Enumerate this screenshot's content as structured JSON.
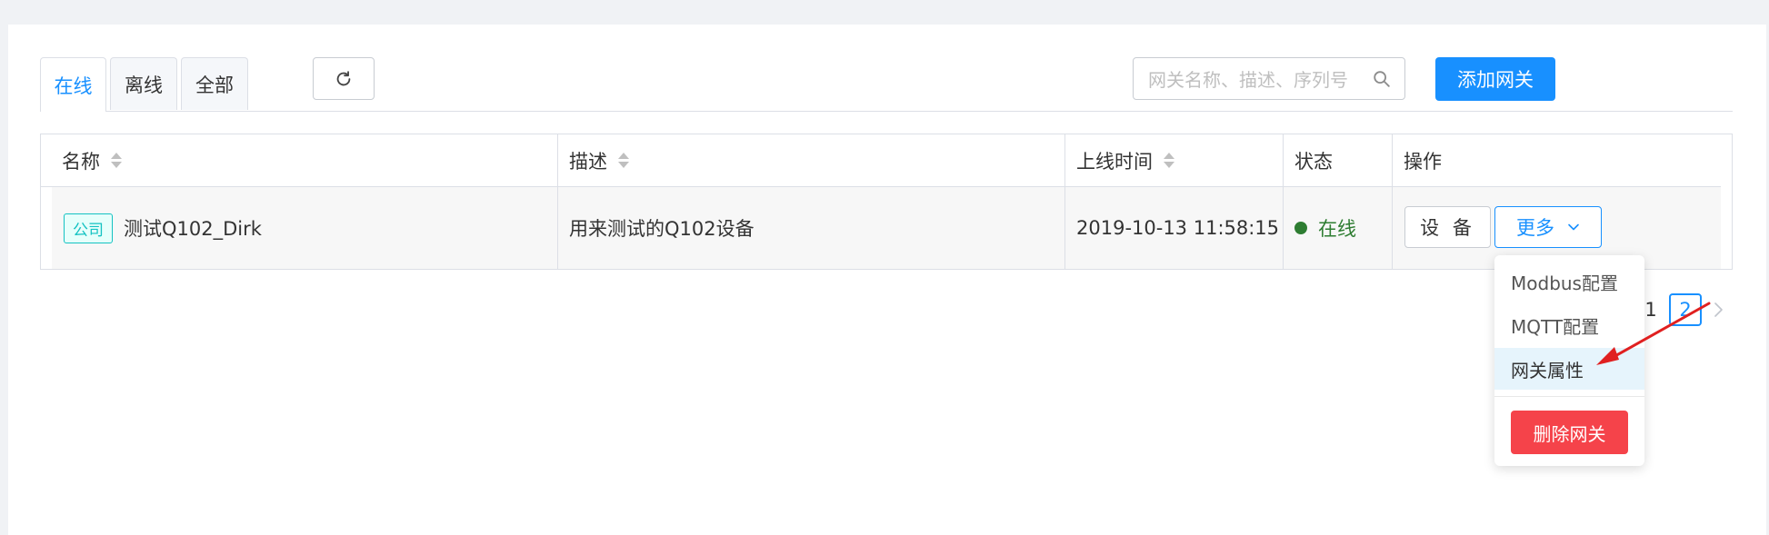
{
  "tabs": [
    {
      "label": "在线",
      "active": true
    },
    {
      "label": "离线",
      "active": false
    },
    {
      "label": "全部",
      "active": false
    }
  ],
  "search": {
    "placeholder": "网关名称、描述、序列号",
    "value": ""
  },
  "toolbar": {
    "add_label": "添加网关"
  },
  "table": {
    "headers": [
      "名称",
      "描述",
      "上线时间",
      "状态",
      "操作"
    ],
    "rows": [
      {
        "tag": "公司",
        "name": "测试Q102_Dirk",
        "description": "用来测试的Q102设备",
        "online_time": "2019-10-13 11:58:15",
        "status": "在线",
        "actions": {
          "device_label": "设 备",
          "more_label": "更多"
        }
      }
    ]
  },
  "pagination": {
    "pages": [
      "1",
      "2"
    ],
    "current": "2"
  },
  "dropdown": {
    "items": [
      "Modbus配置",
      "MQTT配置",
      "网关属性"
    ],
    "hovered": "网关属性",
    "delete_label": "删除网关"
  },
  "colors": {
    "primary": "#1890ff",
    "danger": "#f5434a",
    "online": "#2e7d32",
    "tag": "#13c2c2",
    "annotation": "#e02020"
  },
  "icons": [
    "refresh-icon",
    "search-icon",
    "sort-icon",
    "chevron-down-icon",
    "chevron-right-icon",
    "arrow-annotation"
  ]
}
